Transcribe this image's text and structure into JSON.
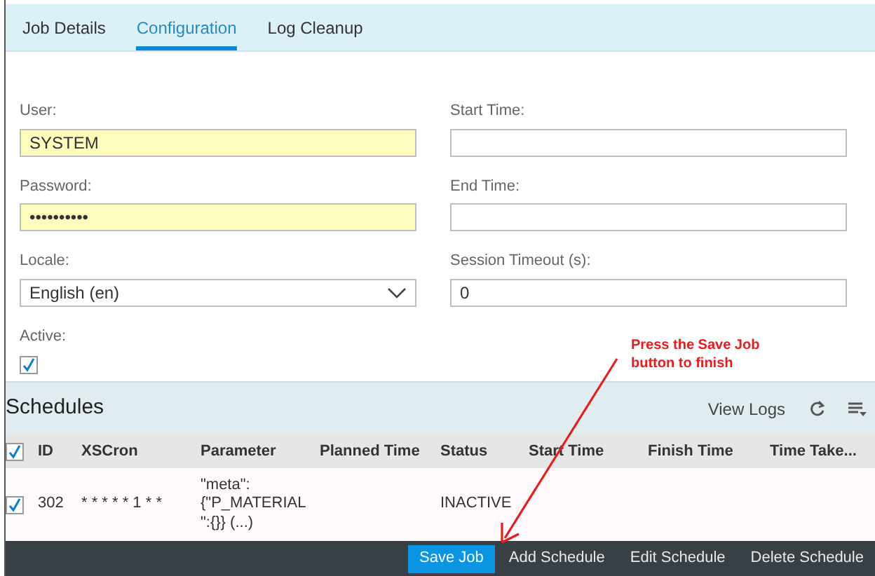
{
  "tabs": [
    {
      "label": "Job Details",
      "selected": false
    },
    {
      "label": "Configuration",
      "selected": true
    },
    {
      "label": "Log Cleanup",
      "selected": false
    }
  ],
  "form": {
    "left": [
      {
        "kind": "text",
        "label": "User:",
        "value": "SYSTEM",
        "highlighted": true
      },
      {
        "kind": "text",
        "label": "Password:",
        "value": "••••••••••",
        "highlighted": true
      },
      {
        "kind": "select",
        "label": "Locale:",
        "value": "English (en)",
        "highlighted": false
      },
      {
        "kind": "checkbox",
        "label": "Active:",
        "checked": true
      }
    ],
    "right": [
      {
        "kind": "text",
        "label": "Start Time:",
        "highlighted": false
      },
      {
        "kind": "text",
        "label": "End Time:",
        "highlighted": false
      },
      {
        "kind": "text",
        "label": "Session Timeout (s):",
        "value": "0",
        "highlighted": false
      }
    ]
  },
  "annotation": {
    "text": "Press the Save Job button to finish"
  },
  "schedules": {
    "title": "Schedules",
    "view_logs": "View Logs",
    "header_checked": true,
    "columns": [
      "ID",
      "XSCron",
      "Parameter",
      "Planned Time",
      "Status",
      "Start Time",
      "Finish Time",
      "Time Take..."
    ],
    "rows": [
      {
        "checked": true,
        "cells": [
          "302",
          "* * * * * 1 * *",
          "\"meta\": {\"P_MATERIAL \":{}} (...)",
          "",
          "INACTIVE",
          "",
          "",
          ""
        ]
      }
    ]
  },
  "footer": [
    {
      "label": "Save Job",
      "primary": true
    },
    {
      "label": "Add Schedule",
      "primary": false
    },
    {
      "label": "Edit Schedule",
      "primary": false
    },
    {
      "label": "Delete Schedule",
      "primary": false
    }
  ]
}
